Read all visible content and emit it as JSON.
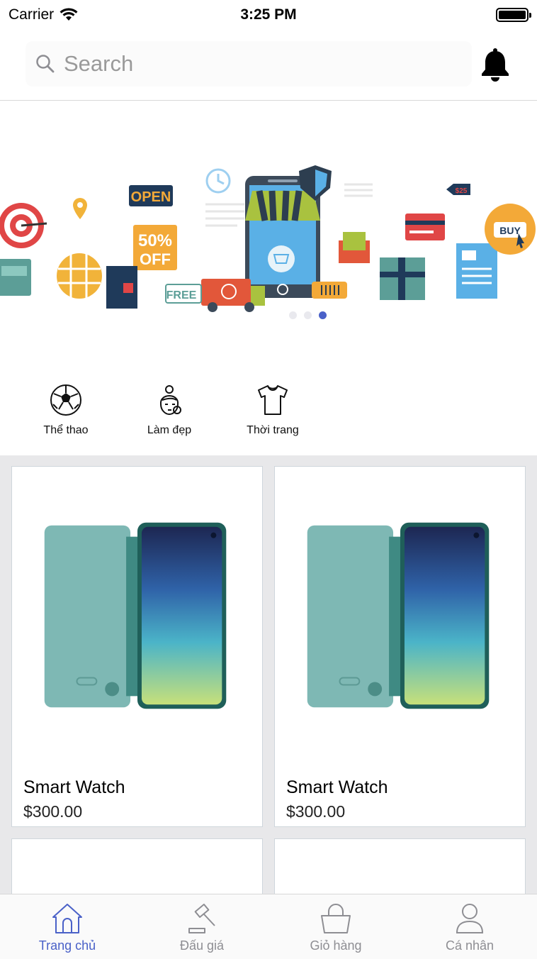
{
  "status_bar": {
    "carrier": "Carrier",
    "time": "3:25 PM"
  },
  "header": {
    "search_placeholder": "Search",
    "icons": [
      "search-icon",
      "bell-icon"
    ]
  },
  "banner": {
    "slide_count": 3,
    "active_slide": 3
  },
  "categories": [
    {
      "label": "Thể thao",
      "icon": "soccer-ball-icon"
    },
    {
      "label": "Làm đẹp",
      "icon": "woman-face-icon"
    },
    {
      "label": "Thời trang",
      "icon": "t-shirt-icon"
    }
  ],
  "products": [
    {
      "name": "Smart Watch",
      "price": "$300.00"
    },
    {
      "name": "Smart Watch",
      "price": "$300.00"
    },
    {
      "name": "",
      "price": ""
    },
    {
      "name": "",
      "price": ""
    }
  ],
  "tabbar": {
    "items": [
      {
        "label": "Trang chủ",
        "icon": "home-icon",
        "active": true
      },
      {
        "label": "Đấu giá",
        "icon": "gavel-icon",
        "active": false
      },
      {
        "label": "Giỏ hàng",
        "icon": "basket-icon",
        "active": false
      },
      {
        "label": "Cá nhân",
        "icon": "user-icon",
        "active": false
      }
    ]
  },
  "colors": {
    "accent": "#4a61c8",
    "inactive": "#8e8e93",
    "grid_bg": "#e8e8ea"
  }
}
